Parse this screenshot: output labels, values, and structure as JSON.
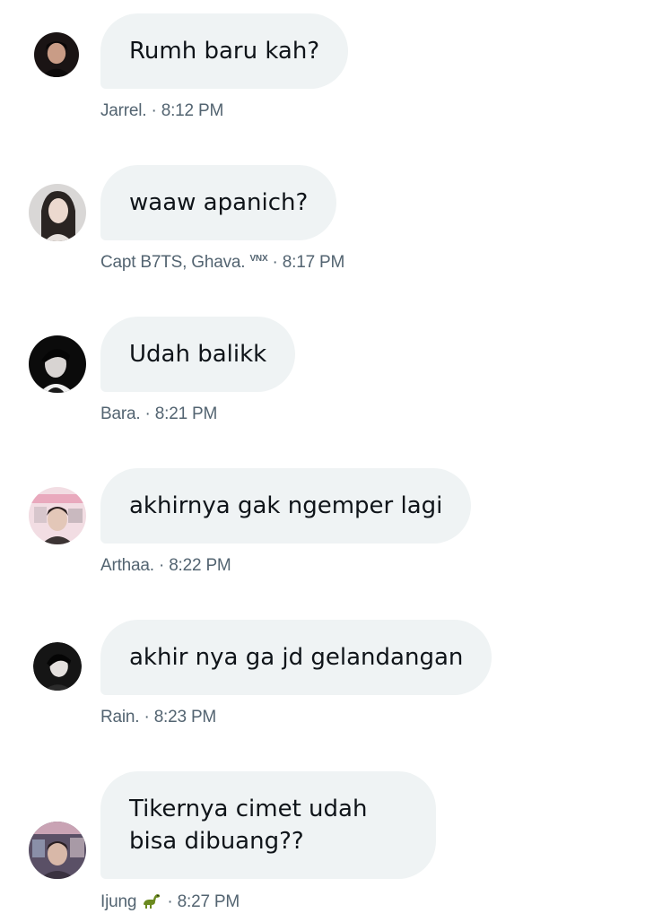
{
  "messages": [
    {
      "text": "Rumh baru kah?",
      "sender": "Jarrel.",
      "time": "8:12 PM",
      "avatar": "avatar-dark-hair"
    },
    {
      "text": "waaw apanich?",
      "sender": "Capt B7TS, Ghava.",
      "sender_suffix": "VNX",
      "time": "8:17 PM",
      "avatar": "avatar-light-bg"
    },
    {
      "text": "Udah balikk",
      "sender": "Bara.",
      "time": "8:21 PM",
      "avatar": "avatar-monochrome"
    },
    {
      "text": "akhirnya gak ngemper lagi",
      "sender": "Arthaa.",
      "time": "8:22 PM",
      "avatar": "avatar-pink-collage"
    },
    {
      "text": "akhir nya ga jd gelandangan",
      "sender": "Rain.",
      "time": "8:23 PM",
      "avatar": "avatar-monochrome-2"
    },
    {
      "text": "Tikernya cimet udah bisa dibuang??",
      "sender": "Ijung",
      "sender_emoji": "dinosaur-icon",
      "time": "8:27 PM",
      "avatar": "avatar-collage-dark"
    }
  ],
  "separator": "·",
  "colors": {
    "bubble": "#eff3f4",
    "text": "#0f1419",
    "meta": "#536471"
  }
}
